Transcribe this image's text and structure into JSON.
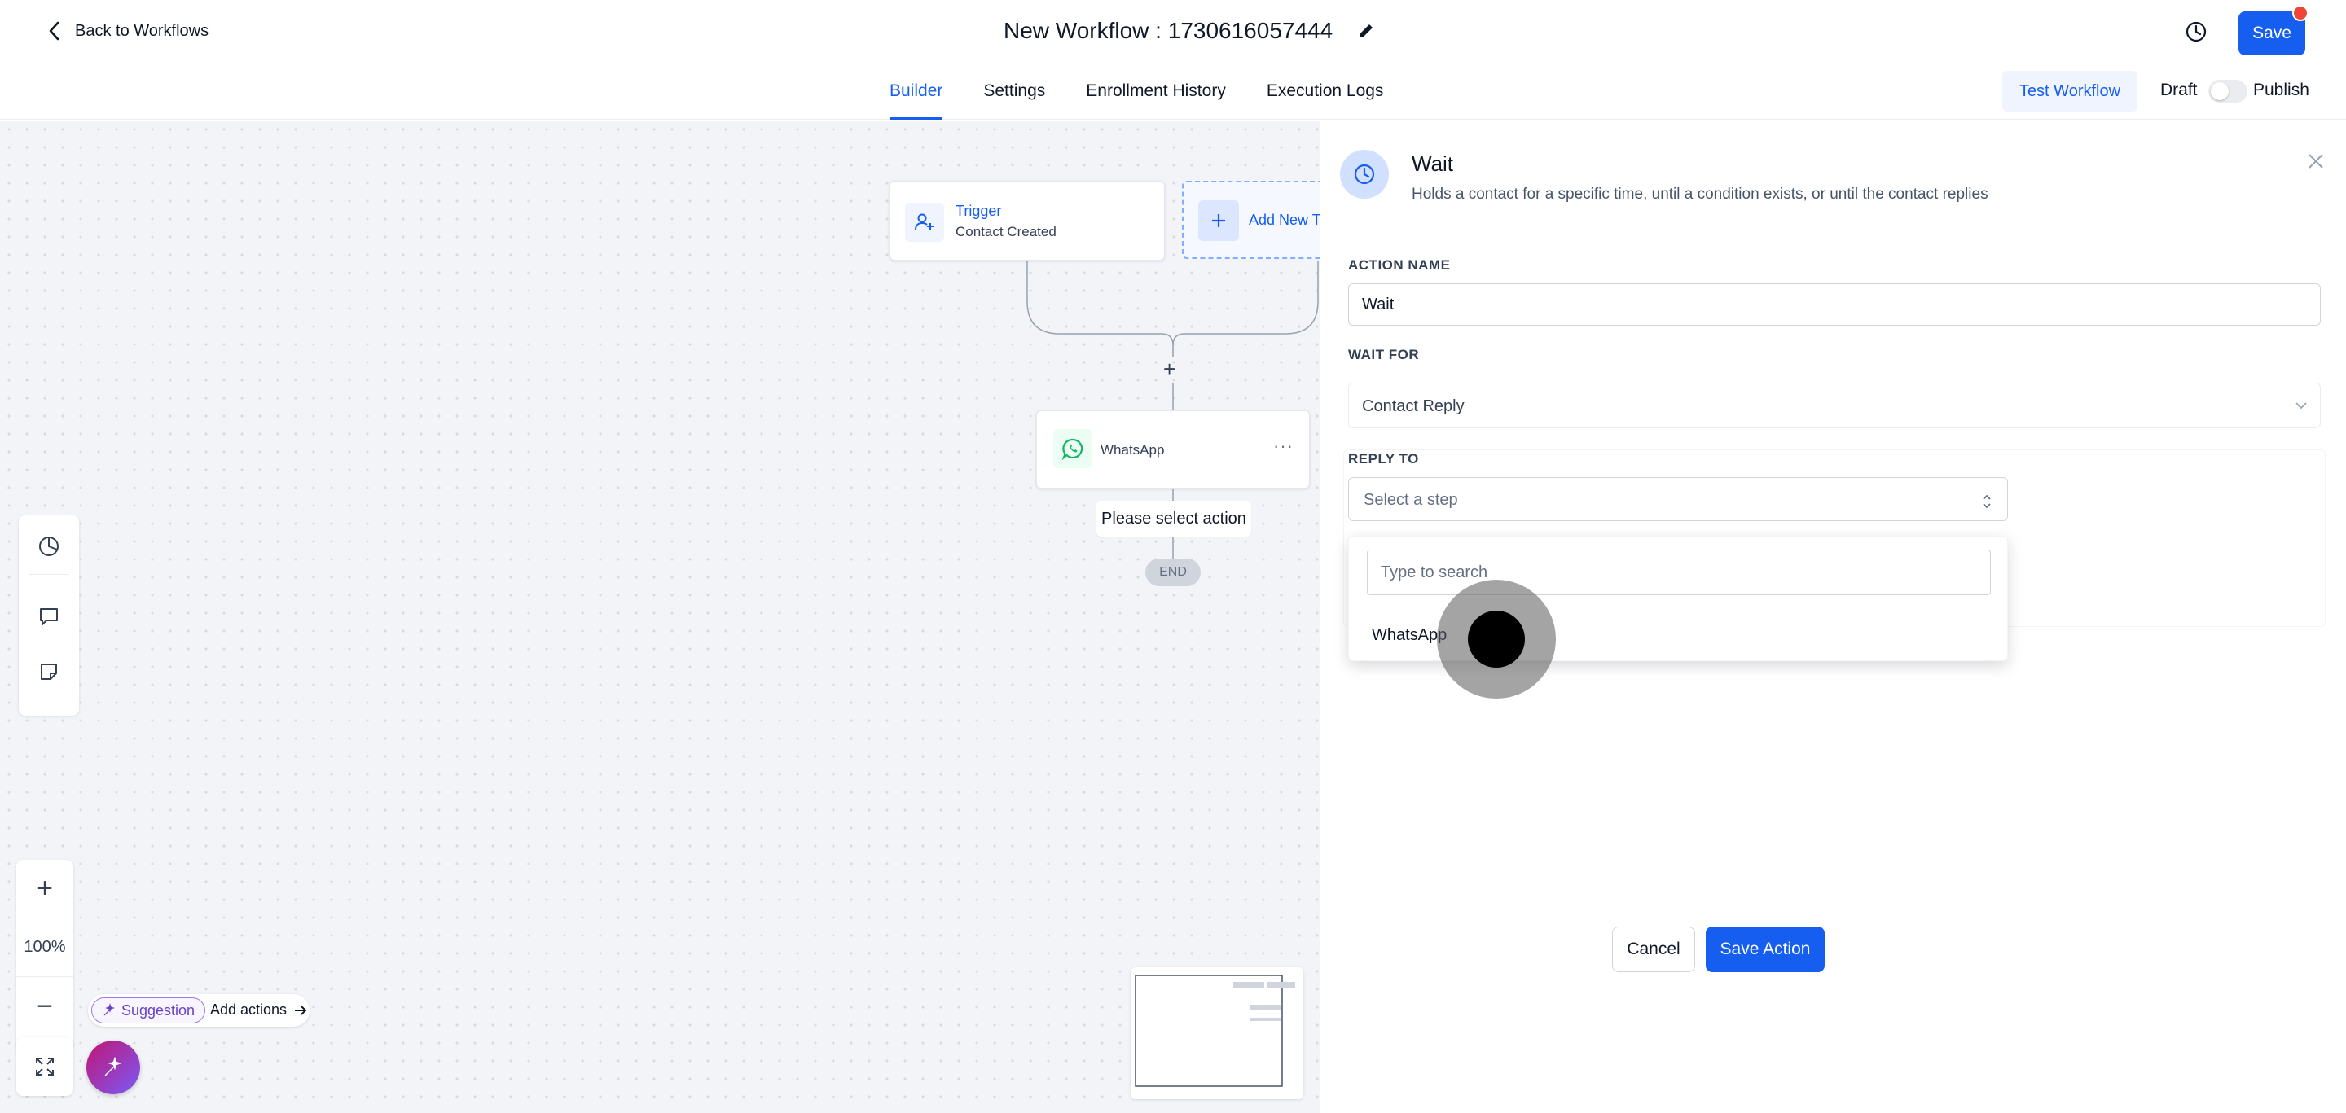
{
  "header": {
    "back_label": "Back to Workflows",
    "workflow_title": "New Workflow : 1730616057444",
    "save_label": "Save"
  },
  "tabs": [
    {
      "label": "Builder",
      "active": true
    },
    {
      "label": "Settings",
      "active": false
    },
    {
      "label": "Enrollment History",
      "active": false
    },
    {
      "label": "Execution Logs",
      "active": false
    }
  ],
  "actions": {
    "test_label": "Test Workflow",
    "draft_label": "Draft",
    "publish_label": "Publish",
    "published": false
  },
  "canvas": {
    "trigger_title": "Trigger",
    "trigger_subtitle": "Contact Created",
    "add_trigger_label": "Add New Tr",
    "whatsapp_node_label": "WhatsApp",
    "placeholder_action": "Please select action",
    "end_label": "END",
    "zoom_level": "100%",
    "suggestion_label": "Suggestion",
    "add_actions_label": "Add actions"
  },
  "drawer": {
    "title": "Wait",
    "description": "Holds a contact for a specific time, until a condition exists, or until the contact replies",
    "action_name_label": "ACTION NAME",
    "action_name_value": "Wait",
    "wait_for_label": "WAIT FOR",
    "wait_for_value": "Contact Reply",
    "reply_to_label": "REPLY TO",
    "reply_to_placeholder": "Select a step",
    "search_placeholder": "Type to search",
    "options": [
      "WhatsApp"
    ],
    "cancel_label": "Cancel",
    "save_action_label": "Save Action"
  },
  "colors": {
    "primary": "#155eef",
    "whatsapp": "#12b76a",
    "notification": "#f04438"
  }
}
